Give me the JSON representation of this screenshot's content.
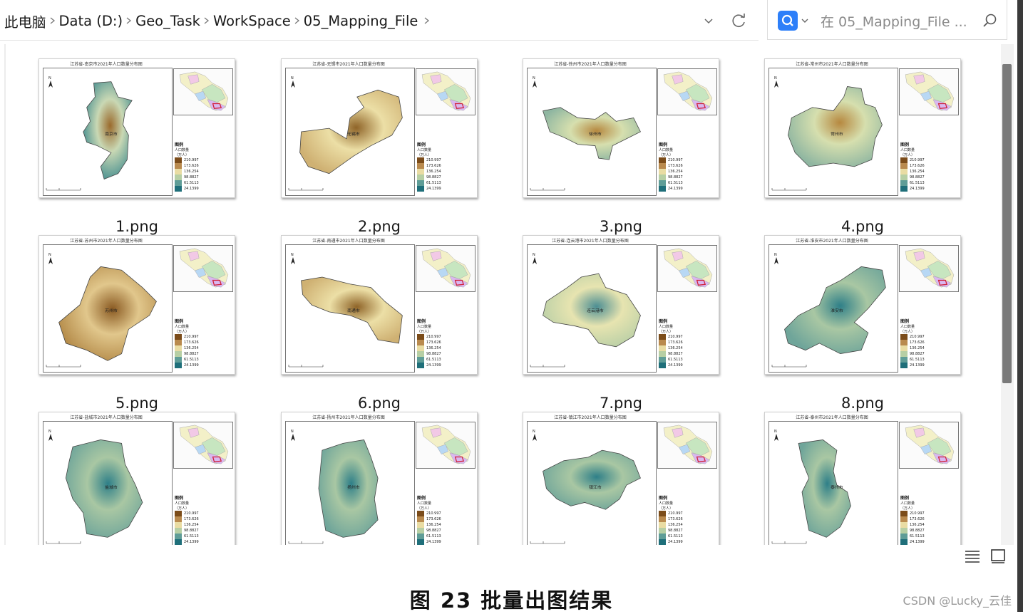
{
  "breadcrumb": {
    "items": [
      "此电脑",
      "Data (D:)",
      "Geo_Task",
      "WorkSpace",
      "05_Mapping_File"
    ]
  },
  "search": {
    "placeholder": "在 05_Mapping_File ..."
  },
  "files": [
    {
      "name": "1.png",
      "title": "江苏省-南京市2021年人口数量分布图",
      "city": "南京市",
      "theme": "brown-teal"
    },
    {
      "name": "2.png",
      "title": "江苏省-无锡市2021年人口数量分布图",
      "city": "无锡市",
      "theme": "light-brown"
    },
    {
      "name": "3.png",
      "title": "江苏省-徐州市2021年人口数量分布图",
      "city": "徐州市",
      "theme": "mixed"
    },
    {
      "name": "4.png",
      "title": "江苏省-常州市2021年人口数量分布图",
      "city": "常州市",
      "theme": "mixed"
    },
    {
      "name": "5.png",
      "title": "江苏省-苏州市2021年人口数量分布图",
      "city": "苏州市",
      "theme": "brown"
    },
    {
      "name": "6.png",
      "title": "江苏省-南通市2021年人口数量分布图",
      "city": "南通市",
      "theme": "light-brown"
    },
    {
      "name": "7.png",
      "title": "江苏省-连云港市2021年人口数量分布图",
      "city": "连云港市",
      "theme": "light-teal"
    },
    {
      "name": "8.png",
      "title": "江苏省-淮安市2021年人口数量分布图",
      "city": "淮安市",
      "theme": "teal"
    },
    {
      "name": "",
      "title": "江苏省-盐城市2021年人口数量分布图",
      "city": "盐城市",
      "theme": "teal"
    },
    {
      "name": "",
      "title": "江苏省-扬州市2021年人口数量分布图",
      "city": "扬州市",
      "theme": "teal"
    },
    {
      "name": "",
      "title": "江苏省-镇江市2021年人口数量分布图",
      "city": "镇江市",
      "theme": "teal"
    },
    {
      "name": "",
      "title": "江苏省-泰州市2021年人口数量分布图",
      "city": "泰州市",
      "theme": "teal"
    }
  ],
  "legend": {
    "heading": "图例",
    "field": "人口数量",
    "unit": "（万人）",
    "values": [
      "210.997",
      "173.626",
      "136.254",
      "98.8827",
      "61.5113",
      "24.1399"
    ]
  },
  "figure_caption": "图  23  批量出图结果",
  "watermark": "CSDN @Lucky_云佳",
  "colors": {
    "accent": "#2d7ff9",
    "high": "#8c5a1e",
    "mid": "#f3ecb8",
    "low": "#1f6f7a"
  }
}
